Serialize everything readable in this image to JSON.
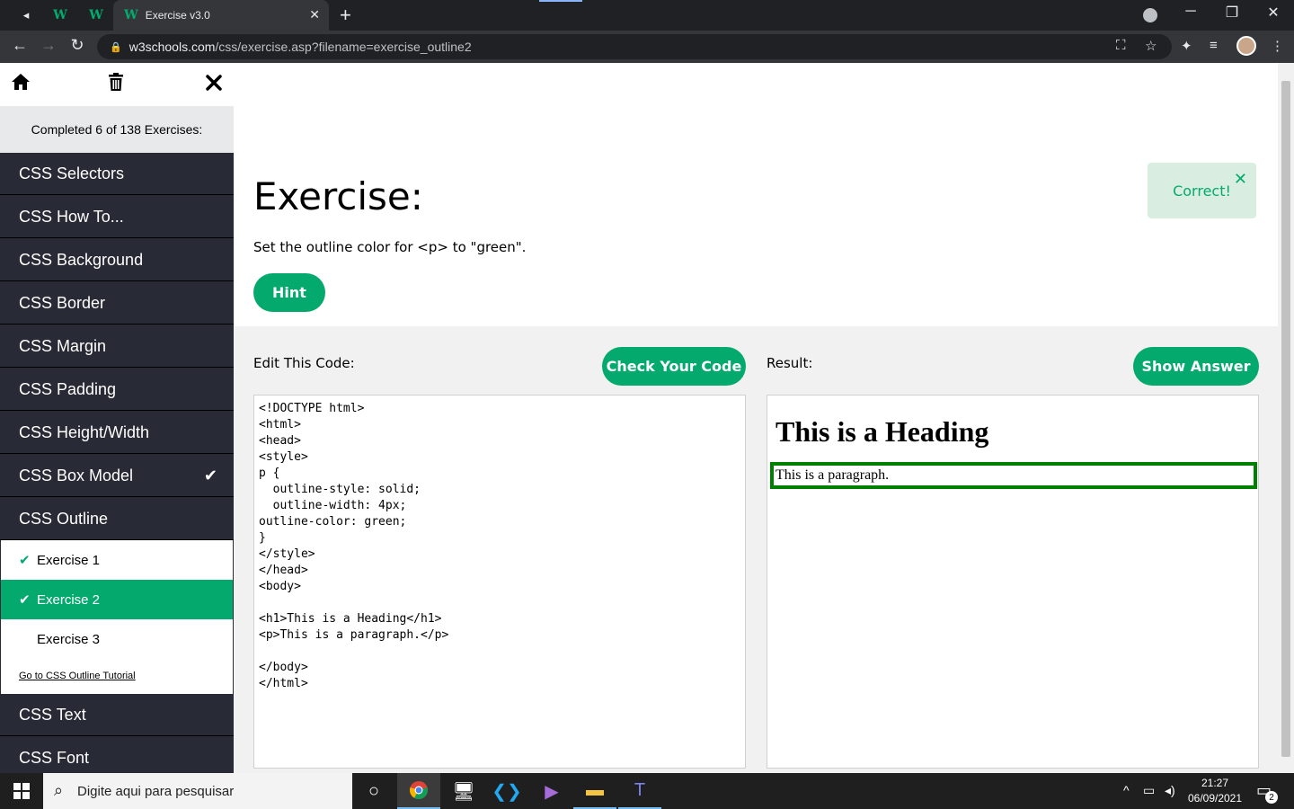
{
  "browser": {
    "active_tab_title": "Exercise v3.0",
    "close_tab_glyph": "✕",
    "new_tab_glyph": "+",
    "pinned_logo": "W",
    "speaker_glyph": "◂",
    "url_host": "w3schools.com",
    "url_path": "/css/exercise.asp?filename=exercise_outline2",
    "window_controls": [
      "─",
      "❐",
      "✕"
    ]
  },
  "sidebar": {
    "progress_text": "Completed 6 of 138 Exercises:",
    "items": [
      {
        "label": "CSS Selectors"
      },
      {
        "label": "CSS How To..."
      },
      {
        "label": "CSS Background"
      },
      {
        "label": "CSS Border"
      },
      {
        "label": "CSS Margin"
      },
      {
        "label": "CSS Padding"
      },
      {
        "label": "CSS Height/Width"
      },
      {
        "label": "CSS Box Model",
        "completed": true
      },
      {
        "label": "CSS Outline"
      },
      {
        "label": "CSS Text"
      },
      {
        "label": "CSS Font"
      }
    ],
    "sub_items": [
      {
        "label": "Exercise 1",
        "done": true
      },
      {
        "label": "Exercise 2",
        "done": true,
        "active": true
      },
      {
        "label": "Exercise 3",
        "done": false
      }
    ],
    "tutorial_link": "Go to CSS Outline Tutorial"
  },
  "exercise": {
    "title": "Exercise:",
    "instruction": "Set the outline color for <p> to \"green\".",
    "hint_label": "Hint",
    "correct_label": "Correct!",
    "edit_label": "Edit This Code:",
    "check_label": "Check Your Code",
    "result_label": "Result:",
    "show_answer_label": "Show Answer",
    "code_lines": [
      "<!DOCTYPE html>",
      "<html>",
      "<head>",
      "<style>",
      "p {",
      "  outline-style: solid;",
      "  outline-width: 4px;",
      "outline-color: green;",
      "}",
      "</style>",
      "</head>",
      "<body>",
      "",
      "<h1>This is a Heading</h1>",
      "<p>This is a paragraph.</p>",
      "",
      "</body>",
      "</html>"
    ],
    "result_heading": "This is a Heading",
    "result_paragraph": "This is a paragraph."
  },
  "taskbar": {
    "search_placeholder": "Digite aqui para pesquisar",
    "time": "21:27",
    "date": "06/09/2021",
    "notification_count": "2"
  },
  "colors": {
    "accent_green": "#04aa6d",
    "sidebar_bg": "#282a35",
    "outline_color": "green"
  }
}
